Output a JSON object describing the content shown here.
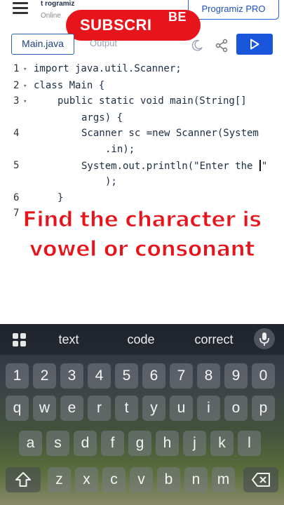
{
  "header": {
    "brand": "t rogramiz",
    "brand_sub": "Online",
    "pro_button": "Programiz PRO",
    "subscribe": "SUBSCRI",
    "subscribe_tail": "BE"
  },
  "tabs": {
    "file_tab": "Main.java",
    "output_tab": "Output"
  },
  "code": {
    "lines": [
      {
        "num": "1",
        "text": "import java.util.Scanner;"
      },
      {
        "num": "2",
        "text": "class Main {"
      },
      {
        "num": "3",
        "text": "public static void main(String[]"
      },
      {
        "num": "",
        "text": "args) {"
      },
      {
        "num": "4",
        "text": "Scanner sc =new Scanner(System"
      },
      {
        "num": "",
        "text": ".in);"
      },
      {
        "num": "5",
        "text_before_cursor": "System.out.println(\"Enter the ",
        "text_after_cursor": "\""
      },
      {
        "num": "",
        "text": ");"
      },
      {
        "num": "6",
        "text": "}"
      },
      {
        "num": "7",
        "text": ""
      }
    ]
  },
  "caption": {
    "line1": "Find the character is",
    "line2": "vowel or consonant"
  },
  "keyboard": {
    "suggestions": [
      "text",
      "code",
      "correct"
    ],
    "row_numbers": [
      "1",
      "2",
      "3",
      "4",
      "5",
      "6",
      "7",
      "8",
      "9",
      "0"
    ],
    "row_top": [
      "q",
      "w",
      "e",
      "r",
      "t",
      "y",
      "u",
      "i",
      "o",
      "p"
    ],
    "row_middle": [
      "a",
      "s",
      "d",
      "f",
      "g",
      "h",
      "j",
      "k",
      "l"
    ],
    "row_bottom": [
      "z",
      "x",
      "c",
      "v",
      "b",
      "n",
      "m"
    ]
  },
  "icons": {
    "menu": "hamburger-icon",
    "theme": "moon-icon",
    "share": "share-icon",
    "run": "play-icon",
    "apps": "grid-icon",
    "voice": "microphone-icon",
    "shift": "shift-icon",
    "backspace": "backspace-icon"
  },
  "colors": {
    "accent": "#1a56db",
    "subscribe": "#e8141b",
    "caption": "#e8141b"
  }
}
